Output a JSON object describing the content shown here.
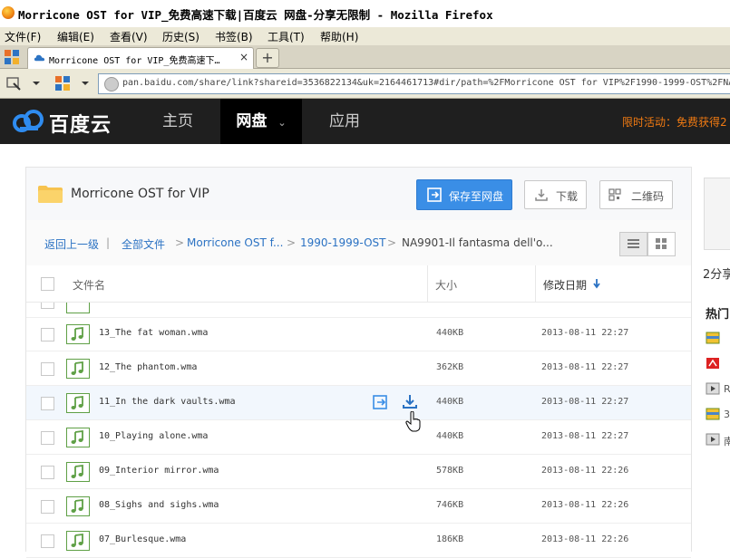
{
  "window": {
    "title": "Morricone OST for VIP_免费高速下载|百度云 网盘-分享无限制 - Mozilla Firefox"
  },
  "menu": [
    "文件(F)",
    "编辑(E)",
    "查看(V)",
    "历史(S)",
    "书签(B)",
    "工具(T)",
    "帮助(H)"
  ],
  "tab": {
    "label": "Morricone OST for VIP_免费高速下…",
    "close": "×",
    "new_tab": "+"
  },
  "address": {
    "url": "pan.baidu.com/share/link?shareid=3536822134&uk=2164461713#dir/path=%2FMorricone OST for VIP%2F1990-1999-OST%2FNA"
  },
  "site": {
    "logo_text": "百度云",
    "nav": [
      {
        "label": "主页"
      },
      {
        "label": "网盘"
      },
      {
        "label": "应用"
      }
    ],
    "promo": "限时活动：免费获得2"
  },
  "folder": {
    "title": "Morricone OST for VIP",
    "save_label": "保存至网盘",
    "download_label": "下载",
    "qrcode_label": "二维码"
  },
  "breadcrumb": {
    "back": "返回上一级",
    "sep_bar": "|",
    "all": "全部文件",
    "sep": ">",
    "p1": "Morricone OST f...",
    "p2": "1990-1999-OST",
    "current": "NA9901-Il fantasma dell'o..."
  },
  "table": {
    "headers": {
      "name": "文件名",
      "size": "大小",
      "date": "修改日期"
    },
    "rows": [
      {
        "name": "13_The fat woman.wma",
        "size": "440KB",
        "date": "2013-08-11 22:27"
      },
      {
        "name": "12_The phantom.wma",
        "size": "362KB",
        "date": "2013-08-11 22:27"
      },
      {
        "name": "11_In the dark vaults.wma",
        "size": "440KB",
        "date": "2013-08-11 22:27"
      },
      {
        "name": "10_Playing alone.wma",
        "size": "440KB",
        "date": "2013-08-11 22:27"
      },
      {
        "name": "09_Interior mirror.wma",
        "size": "578KB",
        "date": "2013-08-11 22:26"
      },
      {
        "name": "08_Sighs and sighs.wma",
        "size": "746KB",
        "date": "2013-08-11 22:26"
      },
      {
        "name": "07_Burlesque.wma",
        "size": "186KB",
        "date": "2013-08-11 22:26"
      }
    ]
  },
  "sidebar": {
    "share": "2分享",
    "hot": "热门",
    "items": [
      "",
      "",
      "R",
      "3",
      "南"
    ]
  },
  "colors": {
    "header_bg": "#1f1f1f",
    "accent_blue": "#3a8ee6",
    "link_blue": "#2b72c3",
    "promo_orange": "#f07a12",
    "music_green": "#5fa046"
  }
}
